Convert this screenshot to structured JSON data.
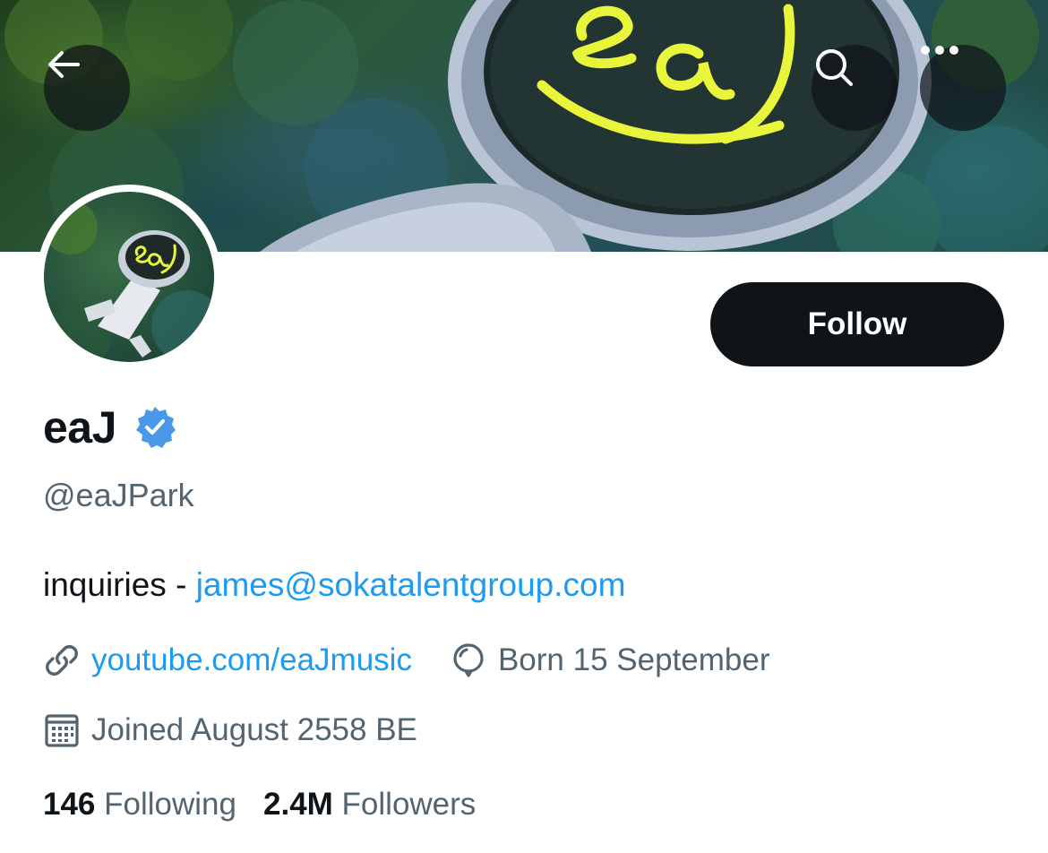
{
  "banner": {
    "alt": "Astronaut lying in moss with eaJ visor"
  },
  "topbar": {
    "back_icon": "arrow-left-icon",
    "search_icon": "search-icon",
    "more_icon": "more-horizontal-icon"
  },
  "profile": {
    "display_name": "eaJ",
    "verified": true,
    "handle": "@eaJPark",
    "follow_label": "Follow",
    "bio_prefix": "inquiries - ",
    "bio_email": "james@sokatalentgroup.com",
    "website": "youtube.com/eaJmusic",
    "birthday": "Born 15 September",
    "joined": "Joined August 2558 BE",
    "following_count": "146",
    "following_label": "Following",
    "followers_count": "2.4M",
    "followers_label": "Followers"
  },
  "colors": {
    "accent": "#1d9bf0",
    "text_primary": "#0f1419",
    "text_secondary": "#536471",
    "button_dark": "#0f1419",
    "verified_blue": "#4a99e9",
    "visor_yellow": "#e8f53a"
  }
}
